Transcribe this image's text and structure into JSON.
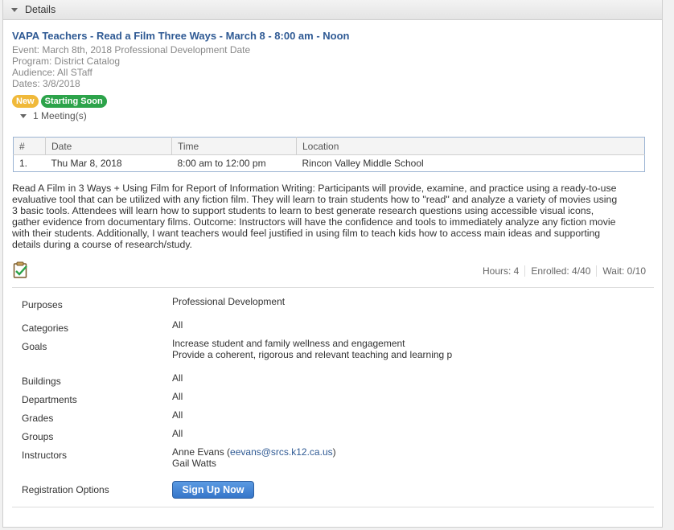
{
  "panel": {
    "header_title": "Details"
  },
  "course": {
    "title": "VAPA Teachers - Read a Film Three Ways - March 8 - 8:00 am - Noon",
    "event": "Event: March 8th, 2018 Professional Development Date",
    "program": "Program: District Catalog",
    "audience": "Audience: All STaff",
    "dates": "Dates: 3/8/2018",
    "badges": {
      "new": "New",
      "soon": "Starting Soon"
    },
    "meetings_toggle": "1 Meeting(s)",
    "meetings_table": {
      "headers": [
        "#",
        "Date",
        "Time",
        "Location"
      ],
      "rows": [
        [
          "1.",
          "Thu Mar 8, 2018",
          "8:00 am to 12:00 pm",
          "Rincon Valley Middle School"
        ]
      ]
    },
    "description_lines": [
      "Read A Film in 3 Ways + Using Film for Report of Information Writing: Participants will provide, examine, and practice using a ready-to-use",
      "evaluative tool that can be utilized with any fiction film. They will learn to train students how to \"read\" and analyze a variety of movies using",
      "3 basic tools. Attendees will learn how to support students to learn to best generate research questions using accessible visual icons,",
      "gather evidence from documentary films. Outcome: Instructors will have the confidence and tools to immediately analyze any fiction movie",
      "with their students. Additionally, I want teachers would feel justified in using film to teach kids how to access main ideas and supporting",
      "details during a course of research/study."
    ],
    "stats": {
      "hours": "Hours: 4",
      "enrolled": "Enrolled: 4/40",
      "wait": "Wait: 0/10"
    },
    "details": {
      "purposes": {
        "label": "Purposes",
        "value": "Professional Development"
      },
      "categories": {
        "label": "Categories",
        "value": "All"
      },
      "goals": {
        "label": "Goals",
        "value1": "Increase student and family wellness and engagement",
        "value2": "Provide a coherent, rigorous and relevant teaching and learning p"
      },
      "buildings": {
        "label": "Buildings",
        "value": "All"
      },
      "departments": {
        "label": "Departments",
        "value": "All"
      },
      "grades": {
        "label": "Grades",
        "value": "All"
      },
      "groups": {
        "label": "Groups",
        "value": "All"
      },
      "instructors": {
        "label": "Instructors",
        "instructor1_name": "Anne Evans (",
        "instructor1_email": "eevans@srcs.k12.ca.us",
        "instructor1_close": ")",
        "instructor2": "Gail Watts"
      },
      "registration": {
        "label": "Registration Options",
        "button": "Sign Up Now"
      }
    }
  },
  "colors": {
    "title": "#2f5a94",
    "badge_new": "#f0b93a",
    "badge_soon": "#2ca34a",
    "button": "#3f82d6"
  },
  "icons": {
    "collapse": "chevron-down-icon",
    "clipboard": "clipboard-check-icon"
  }
}
